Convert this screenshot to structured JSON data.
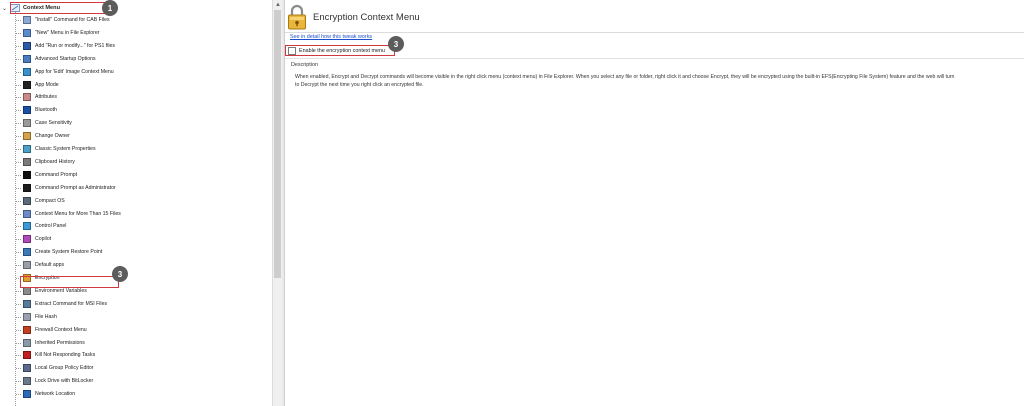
{
  "tree": {
    "root_label": "Context Menu",
    "items": [
      "\"Install\" Command for CAB Files",
      "\"New\" Menu in File Explorer",
      "Add \"Run or modify...\" for PS1 files",
      "Advanced Startup Options",
      "App for 'Edit' Image Context Menu",
      "App Mode",
      "Attributes",
      "Bluetooth",
      "Case Sensitivity",
      "Change Owner",
      "Classic System Properties",
      "Clipboard History",
      "Command Prompt",
      "Command Prompt as Administrator",
      "Compact OS",
      "Context Menu for More Than 15 Files",
      "Control Panel",
      "Copilot",
      "Create System Restore Point",
      "Default apps",
      "Encryption",
      "Environment Variables",
      "Extract Command for MSI Files",
      "File Hash",
      "Firewall Context Menu",
      "Inherited Permissions",
      "Kill Not Responding Tasks",
      "Local Group Policy Editor",
      "Lock Drive with BitLocker",
      "Network Location"
    ]
  },
  "icons": [
    "cab-file-icon",
    "new-menu-icon",
    "powershell-icon",
    "startup-options-icon",
    "image-edit-icon",
    "app-mode-icon",
    "attributes-icon",
    "bluetooth-icon",
    "case-sensitivity-icon",
    "change-owner-icon",
    "system-properties-icon",
    "clipboard-icon",
    "command-prompt-icon",
    "admin-prompt-icon",
    "compact-os-icon",
    "context-menu-icon",
    "control-panel-icon",
    "copilot-icon",
    "restore-point-icon",
    "default-apps-icon",
    "encryption-icon",
    "environment-variables-icon",
    "msi-file-icon",
    "file-hash-icon",
    "firewall-icon",
    "permissions-icon",
    "kill-tasks-icon",
    "group-policy-icon",
    "bitlocker-icon",
    "network-location-icon"
  ],
  "badges": {
    "b1": "1",
    "b2": "3",
    "b3": "3"
  },
  "panel": {
    "title": "Encryption Context Menu",
    "link_text": "See in detail how this tweak works",
    "checkbox_label": "Enable the encryption context menu",
    "checkbox_checked": false,
    "description_heading": "Description",
    "description_line1": "When enabled, Encrypt and Decrypt commands will become visible in the right click menu (context menu) in File Explorer. When you select any file or folder, right click it and choose Encrypt, they will be encrypted using the built-in EFS(Encrypting File System) feature and the web will turn",
    "description_line2": "to Decrypt the next time you right click an encrypted file."
  },
  "colors": {
    "highlight": "#d1373f",
    "badge": "#5c5c5c",
    "link": "#1f4fd0"
  }
}
